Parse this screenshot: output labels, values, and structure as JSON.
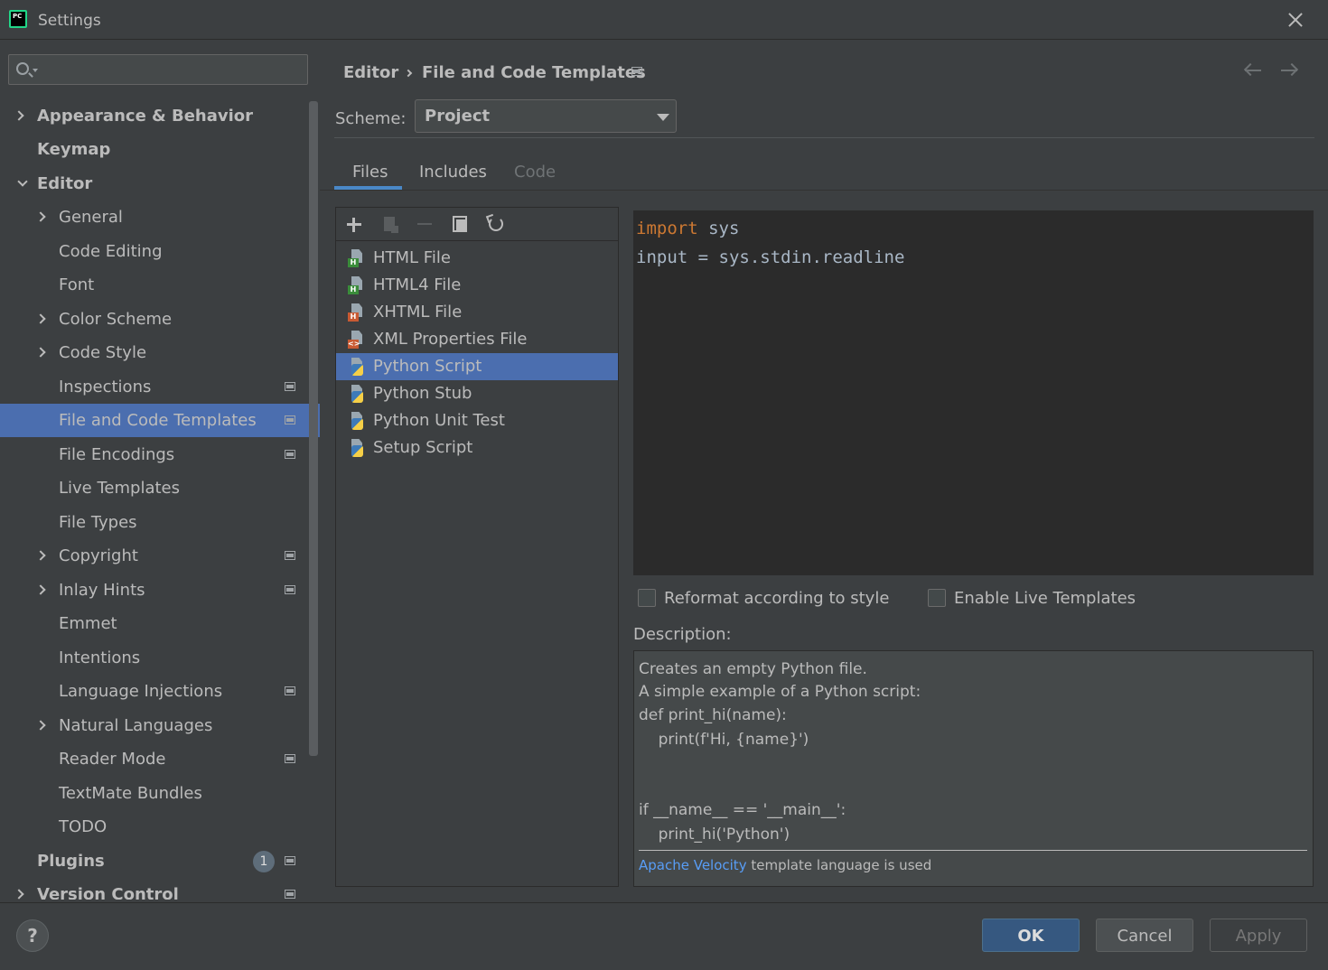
{
  "window": {
    "title": "Settings"
  },
  "search": {
    "placeholder": ""
  },
  "sidebar": {
    "items": [
      {
        "label": "Appearance & Behavior"
      },
      {
        "label": "Keymap"
      },
      {
        "label": "Editor"
      },
      {
        "label": "General"
      },
      {
        "label": "Code Editing"
      },
      {
        "label": "Font"
      },
      {
        "label": "Color Scheme"
      },
      {
        "label": "Code Style"
      },
      {
        "label": "Inspections"
      },
      {
        "label": "File and Code Templates"
      },
      {
        "label": "File Encodings"
      },
      {
        "label": "Live Templates"
      },
      {
        "label": "File Types"
      },
      {
        "label": "Copyright"
      },
      {
        "label": "Inlay Hints"
      },
      {
        "label": "Emmet"
      },
      {
        "label": "Intentions"
      },
      {
        "label": "Language Injections"
      },
      {
        "label": "Natural Languages"
      },
      {
        "label": "Reader Mode"
      },
      {
        "label": "TextMate Bundles"
      },
      {
        "label": "TODO"
      },
      {
        "label": "Plugins",
        "badge": "1"
      },
      {
        "label": "Version Control"
      }
    ]
  },
  "header": {
    "breadcrumb_parent": "Editor",
    "breadcrumb_current": "File and Code Templates"
  },
  "scheme": {
    "label": "Scheme:",
    "value": "Project"
  },
  "tabs": [
    {
      "label": "Files",
      "active": true
    },
    {
      "label": "Includes"
    },
    {
      "label": "Code",
      "disabled": true
    }
  ],
  "templates": [
    {
      "name": "HTML File",
      "icon": "html-file-icon"
    },
    {
      "name": "HTML4 File",
      "icon": "html-file-icon"
    },
    {
      "name": "XHTML File",
      "icon": "xhtml-file-icon"
    },
    {
      "name": "XML Properties File",
      "icon": "xml-file-icon"
    },
    {
      "name": "Python Script",
      "icon": "python-file-icon",
      "selected": true
    },
    {
      "name": "Python Stub",
      "icon": "python-file-icon"
    },
    {
      "name": "Python Unit Test",
      "icon": "python-file-icon"
    },
    {
      "name": "Setup Script",
      "icon": "python-file-icon"
    }
  ],
  "editor": {
    "line1_keyword": "import",
    "line1_rest": " sys",
    "line2": "input = sys.stdin.readline"
  },
  "options": {
    "reformat_label": "Reformat according to style",
    "live_templates_label": "Enable Live Templates"
  },
  "description": {
    "label": "Description:",
    "lines": [
      "Creates an empty Python file.",
      "A simple example of a Python script:",
      "def print_hi(name):",
      "    print(f'Hi, {name}')",
      "if __name__ == '__main__':",
      "    print_hi('Python')"
    ],
    "link": "Apache Velocity",
    "footer_rest": " template language is used"
  },
  "footer": {
    "help_label": "?",
    "ok_label": "OK",
    "cancel_label": "Cancel",
    "apply_label": "Apply"
  },
  "colors": {
    "accent": "#4b6eaf",
    "primary_button": "#365880",
    "keyword": "#cc7832"
  }
}
